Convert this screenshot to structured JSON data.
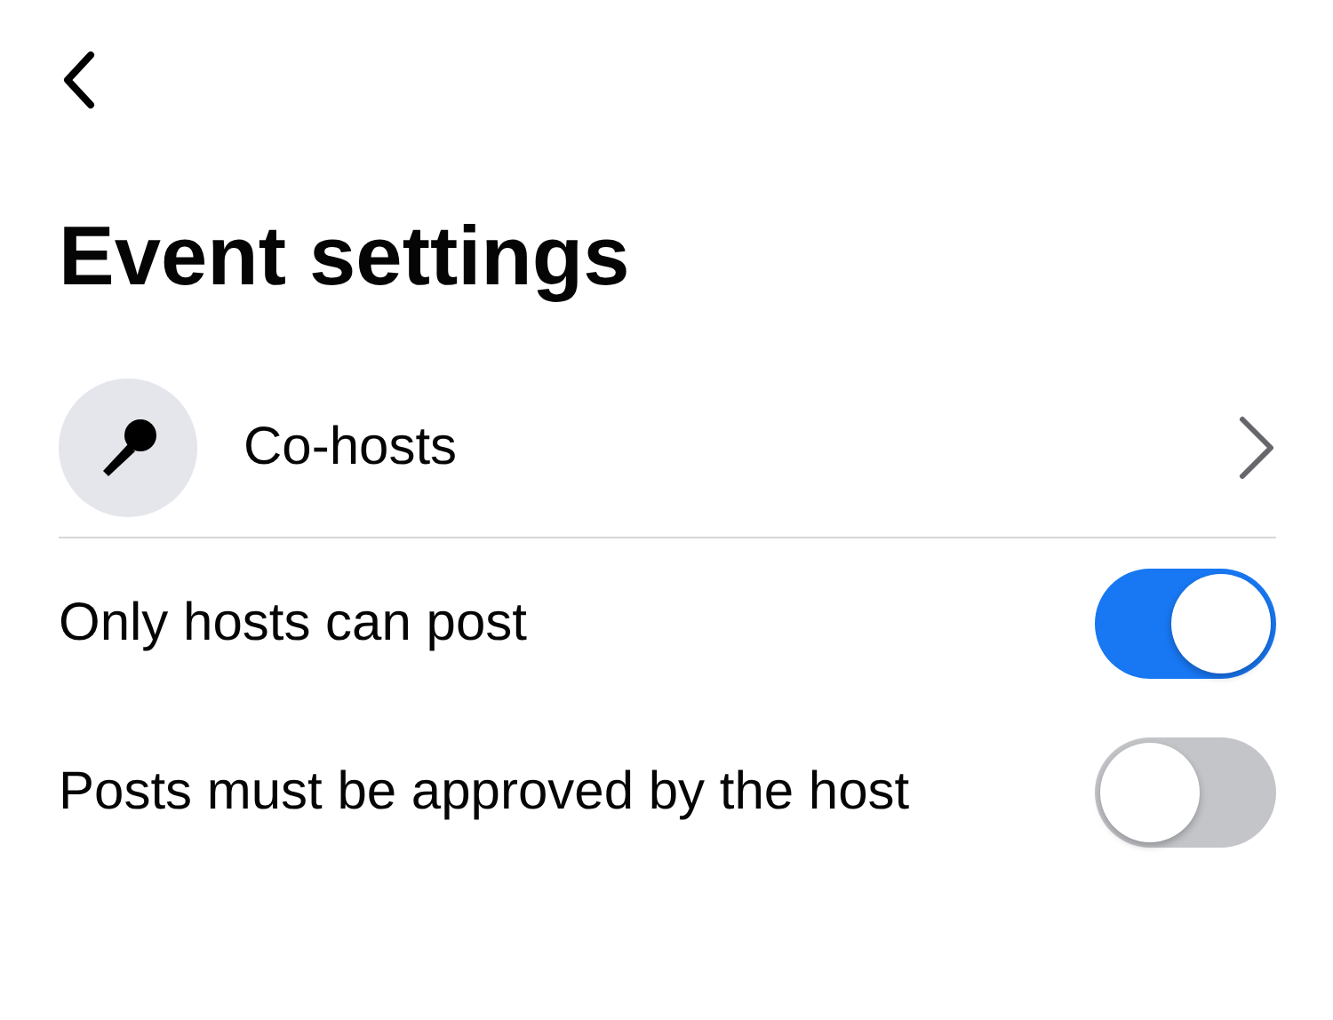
{
  "header": {
    "title": "Event settings"
  },
  "link_row": {
    "label": "Co-hosts"
  },
  "toggles": [
    {
      "label": "Only hosts can post",
      "on": true
    },
    {
      "label": "Posts must be approved by the host",
      "on": false
    }
  ]
}
